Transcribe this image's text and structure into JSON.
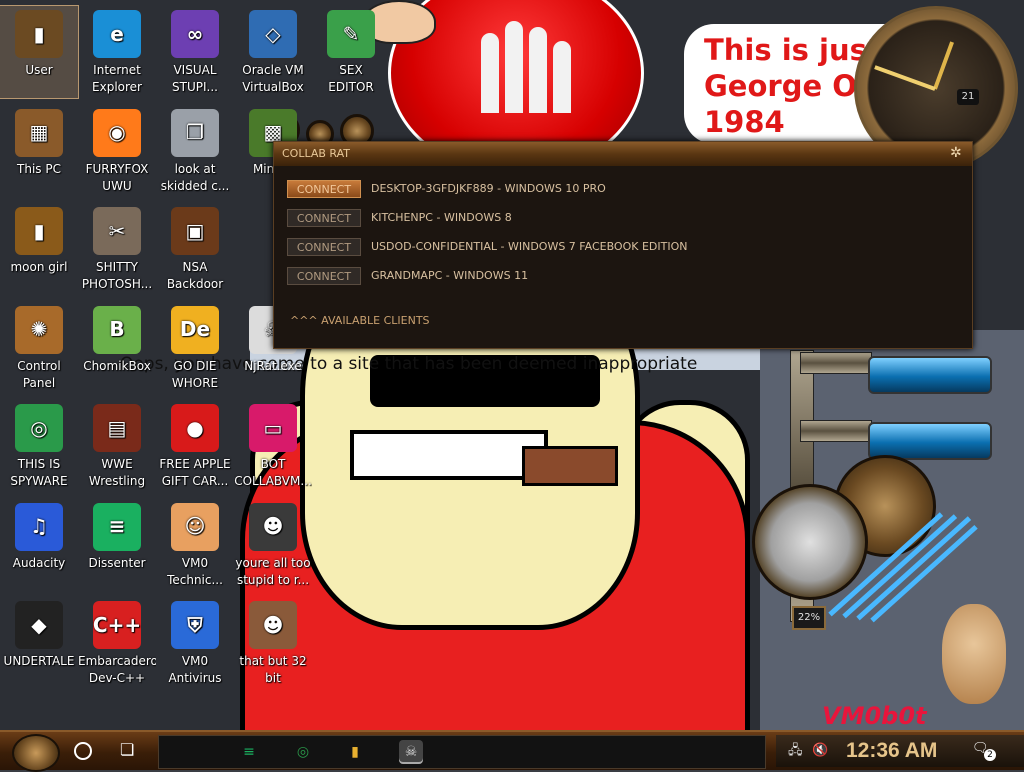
{
  "wallpaper": {
    "quote_text": "This is just\nGeorge Orwell\n1984",
    "meme_text": "Oops, you have come to a site that has been deemed inappropriate",
    "brand_logo_text": "VM0b0t",
    "gauge_percent_text": "22%",
    "clock_day": "21"
  },
  "desktop": {
    "icons": [
      {
        "id": "user",
        "label": "User",
        "icon": "folder-icon",
        "color": "#6b4a22",
        "selected": true
      },
      {
        "id": "internet-explorer",
        "label": "Internet\nExplorer",
        "icon": "edge-icon",
        "color": "#1a8fd6"
      },
      {
        "id": "visual-studio",
        "label": "VISUAL\nSTUPI...",
        "icon": "visual-studio-icon",
        "color": "#6d3fb2"
      },
      {
        "id": "virtualbox",
        "label": "Oracle VM\nVirtualBox",
        "icon": "virtualbox-icon",
        "color": "#2f6cb3"
      },
      {
        "id": "sex-editor",
        "label": "SEX\nEDITOR",
        "icon": "editor-icon",
        "color": "#3aa04a"
      },
      {
        "id": "this-pc",
        "label": "This PC",
        "icon": "computer-icon",
        "color": "#8a5a2a"
      },
      {
        "id": "furryfox",
        "label": "FURRYFOX\nUWU",
        "icon": "firefox-icon",
        "color": "#ff7a1a"
      },
      {
        "id": "look-at-skidded",
        "label": "look at\nskidded c...",
        "icon": "copy-icon",
        "color": "#9aa0a8"
      },
      {
        "id": "minecraft",
        "label": "Mine...",
        "icon": "minecraft-icon",
        "color": "#4a7a2a"
      },
      {
        "id": "moon-girl",
        "label": "moon girl",
        "icon": "box-icon",
        "color": "#8a5a1a"
      },
      {
        "id": "shitty-photoshop",
        "label": "SHITTY\nPHOTOSH...",
        "icon": "gimp-icon",
        "color": "#7a6a5a"
      },
      {
        "id": "nsa-backdoor",
        "label": "NSA\nBackdoor",
        "icon": "safe-icon",
        "color": "#6b3a1a"
      },
      {
        "id": "control-panel",
        "label": "Control Panel",
        "icon": "lightbulb-icon",
        "color": "#a86a2a"
      },
      {
        "id": "chomikbox",
        "label": "ChomikBox",
        "icon": "hamster-icon",
        "color": "#6ab04a"
      },
      {
        "id": "go-die-whore",
        "label": "GO DIE\nWHORE",
        "icon": "de-icon",
        "color": "#f0b020"
      },
      {
        "id": "njrat",
        "label": "NjRat.exe",
        "icon": "skull-icon",
        "color": "#dcdcdc"
      },
      {
        "id": "this-is-spyware",
        "label": "THIS IS\nSPYWARE",
        "icon": "chrome-icon",
        "color": "#2a9a4a"
      },
      {
        "id": "wwe-wrestling",
        "label": "WWE\nWrestling",
        "icon": "wrestling-icon",
        "color": "#7a2a1a"
      },
      {
        "id": "free-apple",
        "label": "FREE APPLE\nGIFT CAR...",
        "icon": "apple-icon",
        "color": "#d81a1a"
      },
      {
        "id": "bot-collabvm",
        "label": "BOT\nCOLLABVM...",
        "icon": "monitor-icon",
        "color": "#d81a6a"
      },
      {
        "id": "audacity",
        "label": "Audacity",
        "icon": "audacity-icon",
        "color": "#2a5ad8"
      },
      {
        "id": "dissenter",
        "label": "Dissenter",
        "icon": "dissenter-icon",
        "color": "#1ab060"
      },
      {
        "id": "vm0-technic",
        "label": "VM0\nTechnic...",
        "icon": "doctor-icon",
        "color": "#e8a060"
      },
      {
        "id": "youre-all-too-stupid",
        "label": "youre all too\nstupid to r...",
        "icon": "portrait-icon",
        "color": "#3a3a3a"
      },
      {
        "id": "undertale",
        "label": "UNDERTALE",
        "icon": "unity-icon",
        "color": "#222222"
      },
      {
        "id": "embarcadero",
        "label": "Embarcadero\nDev-C++",
        "icon": "devcpp-icon",
        "color": "#d82020"
      },
      {
        "id": "vm0-antivirus",
        "label": "VM0\nAntivirus",
        "icon": "shield-icon",
        "color": "#2a6ad8"
      },
      {
        "id": "that-but-32-bit",
        "label": "that but 32\nbit",
        "icon": "portrait-icon",
        "color": "#8a5a3a"
      }
    ]
  },
  "rat_window": {
    "title": "COLLAB RAT",
    "connect_label": "CONNECT",
    "clients": [
      {
        "name": "DESKTOP-3GFDJKF889 - WINDOWS 10 PRO",
        "active": true
      },
      {
        "name": "KITCHENPC - WINDOWS 8",
        "active": false
      },
      {
        "name": "USDOD-CONFIDENTIAL - WINDOWS 7 FACEBOOK EDITION",
        "active": false
      },
      {
        "name": "GRANDMAPC - WINDOWS 11",
        "active": false
      }
    ],
    "footer": "^^^ AVAILABLE CLIENTS"
  },
  "taskbar": {
    "pinned": [
      {
        "id": "dissenter",
        "icon": "dissenter-icon",
        "color": "#1ab060"
      },
      {
        "id": "chrome",
        "icon": "chrome-icon",
        "color": "#2a9a4a"
      },
      {
        "id": "file-explorer",
        "icon": "folder-icon",
        "color": "#e8b030"
      },
      {
        "id": "njrat",
        "icon": "skull-icon",
        "color": "#dcdcdc",
        "active": true
      }
    ],
    "clock": "12:36 AM",
    "notification_count": "2"
  }
}
